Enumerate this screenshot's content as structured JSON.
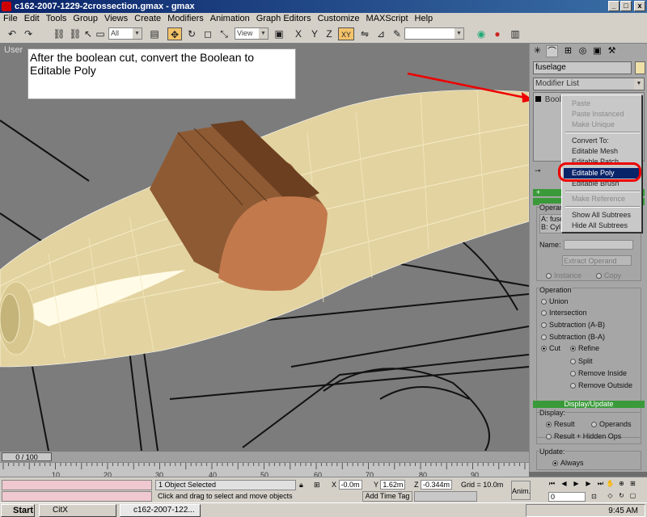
{
  "window": {
    "title": "c162-2007-1229-2crossection.gmax - gmax",
    "min": "_",
    "max": "□",
    "close": "x"
  },
  "menu": [
    "File",
    "Edit",
    "Tools",
    "Group",
    "Views",
    "Create",
    "Modifiers",
    "Animation",
    "Graph Editors",
    "Customize",
    "MAXScript",
    "Help"
  ],
  "toolbar": {
    "selection_filter": "All",
    "ref_coord": "View",
    "named_sel": ""
  },
  "viewport": {
    "label": "User",
    "note": "After the boolean cut, convert the Boolean to Editable Poly"
  },
  "panel": {
    "object_name": "fuselage",
    "object_color": "#efe0a8",
    "modifier_list": "Modifier List",
    "stack_item": "Boolean",
    "plus": "+",
    "operands_label": "Operands",
    "operand_a": "A: fuselage",
    "operand_b": "B: Cyl",
    "name_label": "Name:",
    "extract_operand": "Extract Operand",
    "instance": "Instance",
    "copy": "Copy",
    "operation_label": "Operation",
    "operations": [
      "Union",
      "Intersection",
      "Subtraction (A-B)",
      "Subtraction (B-A)"
    ],
    "cut": "Cut",
    "cut_options": [
      "Refine",
      "Split",
      "Remove Inside",
      "Remove Outside"
    ],
    "display_update": "Display/Update",
    "display_label": "Display:",
    "result": "Result",
    "operands": "Operands",
    "result_hidden": "Result + Hidden Ops",
    "update_label": "Update:",
    "always": "Always"
  },
  "context_menu": {
    "paste": "Paste",
    "paste_instanced": "Paste Instanced",
    "make_unique": "Make Unique",
    "convert_to": "Convert To:",
    "editable_mesh": "Editable Mesh",
    "editable_patch": "Editable Patch",
    "editable_poly": "Editable Poly",
    "editable_brush": "Editable Brush",
    "make_reference": "Make Reference",
    "show_all_subtrees": "Show All Subtrees",
    "hide_all_subtrees": "Hide All Subtrees"
  },
  "timeline": {
    "frame_range": "0 / 100",
    "ticks": [
      "10",
      "20",
      "30",
      "40",
      "50",
      "60",
      "70",
      "80",
      "90"
    ]
  },
  "status": {
    "selection": "1 Object Selected",
    "prompt": "Click and drag to select and move objects",
    "x_label": "X",
    "x_val": "-0.0m",
    "y_label": "Y",
    "y_val": "1.62m",
    "z_label": "Z",
    "z_val": "-0.344m",
    "grid": "Grid = 10.0m",
    "add_time_tag": "Add Time Tag",
    "anim": "Anim.",
    "frame": "0"
  },
  "taskbar": {
    "start": "Start",
    "btn1": "CitX",
    "btn2": "c162-2007-122...",
    "clock": "9:45 AM"
  }
}
